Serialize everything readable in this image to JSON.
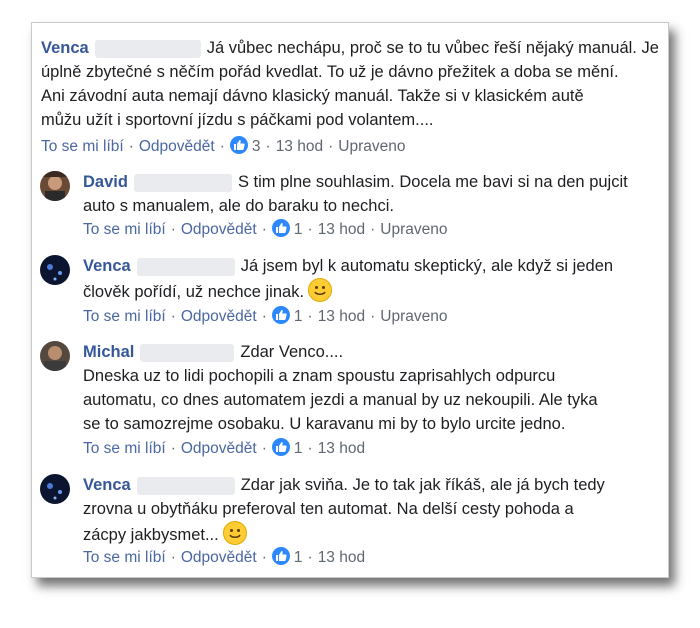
{
  "comments": [
    {
      "author": "Venca",
      "lines": [
        "Já vůbec nechápu, proč se to tu vůbec řeší nějaký manuál. Je",
        "úplně zbytečné s něčím pořád kvedlat. To už je dávno přežitek a doba se mění.",
        "Ani závodní auta nemají dávno klasický manuál. Takže si v klasickém autě",
        "můžu užít i sportovní jízdu s páčkami pod volantem...."
      ],
      "like_label": "To se mi líbí",
      "reply_label": "Odpovědět",
      "reactions": "3",
      "time": "13 hod",
      "edited": "Upraveno"
    },
    {
      "author": "David",
      "lines": [
        "S tim plne souhlasim. Docela me bavi si na den pujcit",
        "auto s manualem, ale do baraku to nechci."
      ],
      "like_label": "To se mi líbí",
      "reply_label": "Odpovědět",
      "reactions": "1",
      "time": "13 hod",
      "edited": "Upraveno"
    },
    {
      "author": "Venca",
      "lines": [
        "Já jsem byl k automatu skeptický, ale když si jeden",
        "člověk pořídí, už nechce jinak."
      ],
      "like_label": "To se mi líbí",
      "reply_label": "Odpovědět",
      "reactions": "1",
      "time": "13 hod",
      "edited": "Upraveno"
    },
    {
      "author": "Michal",
      "lines": [
        "Zdar Venco....",
        "Dneska uz to lidi pochopili a znam spoustu zaprisahlych odpurcu",
        "automatu, co dnes automatem jezdi a manual by uz nekoupili. Ale tyka",
        "se to samozrejme osobaku. U karavanu mi by to bylo urcite jedno."
      ],
      "like_label": "To se mi líbí",
      "reply_label": "Odpovědět",
      "reactions": "1",
      "time": "13 hod"
    },
    {
      "author": "Venca",
      "lines": [
        "Zdar jak sviňa. Je to tak jak říkáš, ale já bych tedy",
        "zrovna u obytňáku preferoval ten automat. Na delší cesty pohoda a",
        "zácpy jakbysmet..."
      ],
      "like_label": "To se mi líbí",
      "reply_label": "Odpovědět",
      "reactions": "1",
      "time": "13 hod"
    }
  ],
  "colors": {
    "author": "#365899",
    "like_blue": "#2d88ff",
    "meta_gray": "#606770"
  }
}
